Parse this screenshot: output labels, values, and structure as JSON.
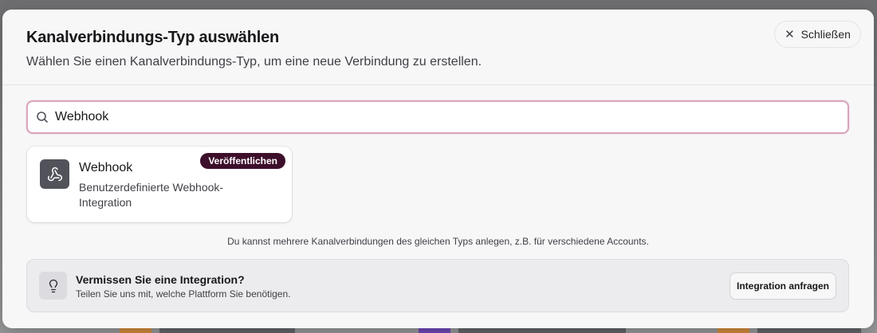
{
  "modal": {
    "title": "Kanalverbindungs-Typ auswählen",
    "subtitle": "Wählen Sie einen Kanalverbindungs-Typ, um eine neue Verbindung zu erstellen.",
    "close_label": "Schließen"
  },
  "search": {
    "value": "Webhook",
    "icon": "search-icon"
  },
  "results": [
    {
      "title": "Webhook",
      "description": "Benutzerdefinierte Webhook-Integration",
      "badge": "Veröffentlichen",
      "icon": "webhook-icon"
    }
  ],
  "hint_text": "Du kannst mehrere Kanalverbindungen des gleichen Typs anlegen, z.B. für verschiedene Accounts.",
  "missing_integration": {
    "title": "Vermissen Sie eine Integration?",
    "subtitle": "Teilen Sie uns mit, welche Plattform Sie benötigen.",
    "button_label": "Integration anfragen",
    "icon": "lightbulb-icon"
  },
  "colors": {
    "badge_bg": "#3d0f2b",
    "search_focus_border": "#d9a6bd",
    "card_icon_bg": "#52525b"
  }
}
